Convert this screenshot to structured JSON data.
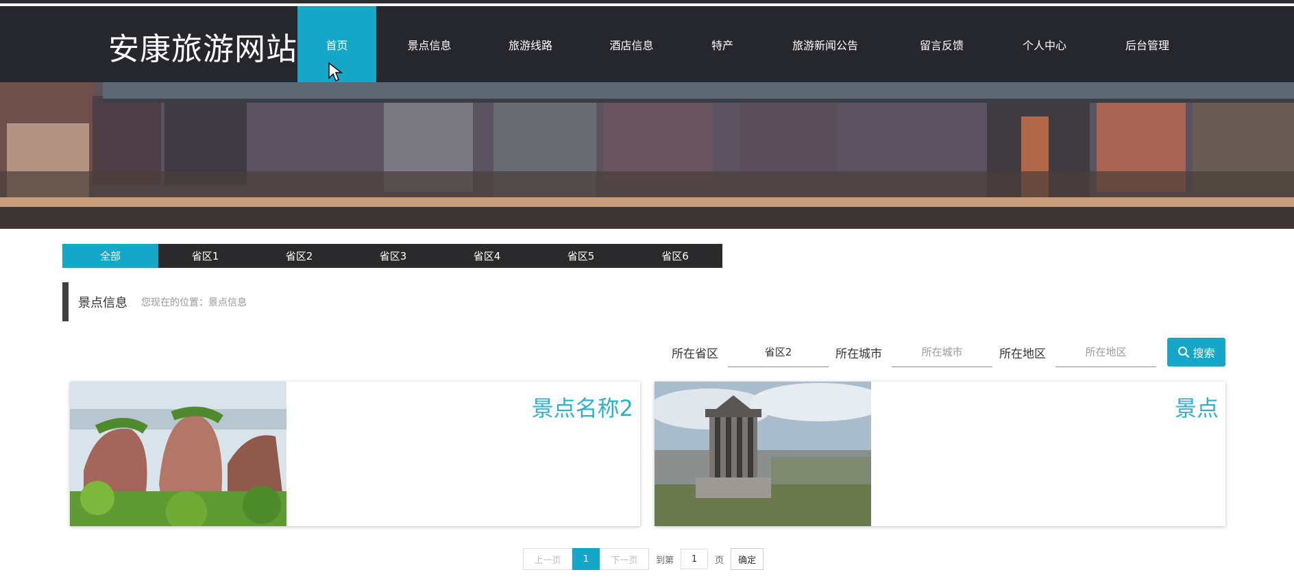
{
  "header": {
    "site_title": "安康旅游网站",
    "nav": [
      {
        "label": "首页",
        "active": true
      },
      {
        "label": "景点信息"
      },
      {
        "label": "旅游线路"
      },
      {
        "label": "酒店信息"
      },
      {
        "label": "特产"
      },
      {
        "label": "旅游新闻公告"
      },
      {
        "label": "留言反馈"
      },
      {
        "label": "个人中心"
      },
      {
        "label": "后台管理"
      }
    ]
  },
  "tabs": [
    "全部",
    "省区1",
    "省区2",
    "省区3",
    "省区4",
    "省区5",
    "省区6"
  ],
  "section": {
    "title": "景点信息",
    "breadcrumb": "您现在的位置：景点信息"
  },
  "search": {
    "province_label": "所在省区",
    "province_value": "省区2",
    "city_label": "所在城市",
    "city_placeholder": "所在城市",
    "district_label": "所在地区",
    "district_placeholder": "所在地区",
    "button_label": "搜索"
  },
  "cards": [
    {
      "name": "景点名称2"
    },
    {
      "name": "景点"
    }
  ],
  "pagination": {
    "prev": "上一页",
    "current": "1",
    "next": "下一页",
    "goto_label": "到第",
    "page_value": "1",
    "page_unit": "页",
    "confirm": "确定"
  },
  "colors": {
    "accent": "#16a7c8",
    "header_bg": "#25272d",
    "card_title": "#2fb0c9"
  }
}
